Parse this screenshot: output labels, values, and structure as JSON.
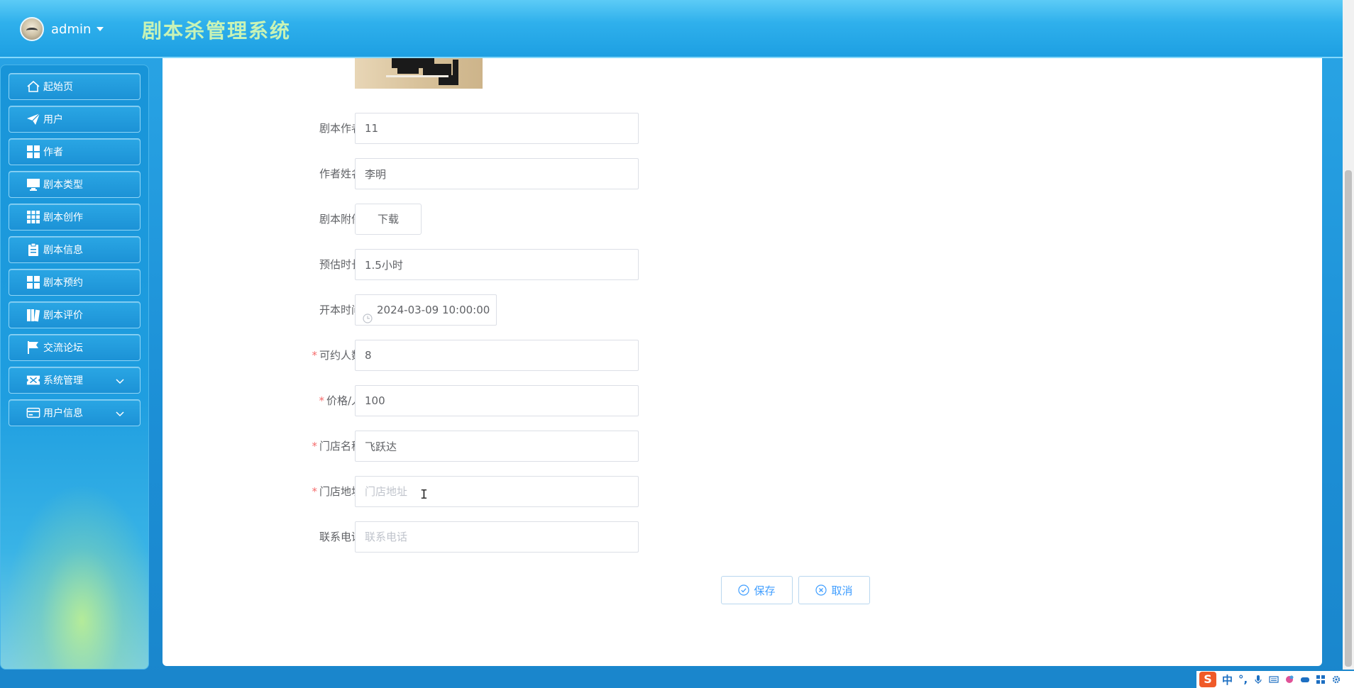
{
  "header": {
    "username": "admin",
    "app_title": "剧本杀管理系统"
  },
  "sidebar": {
    "items": [
      {
        "label": "起始页",
        "icon": "home-icon"
      },
      {
        "label": "用户",
        "icon": "paper-plane-icon"
      },
      {
        "label": "作者",
        "icon": "grid-icon"
      },
      {
        "label": "剧本类型",
        "icon": "monitor-icon"
      },
      {
        "label": "剧本创作",
        "icon": "apps-icon"
      },
      {
        "label": "剧本信息",
        "icon": "clipboard-icon"
      },
      {
        "label": "剧本预约",
        "icon": "grid-icon"
      },
      {
        "label": "剧本评价",
        "icon": "books-icon"
      },
      {
        "label": "交流论坛",
        "icon": "flag-icon"
      },
      {
        "label": "系统管理",
        "icon": "ticket-icon",
        "expandable": true
      },
      {
        "label": "用户信息",
        "icon": "card-icon",
        "expandable": true
      }
    ]
  },
  "form": {
    "author_label": "剧本作者",
    "author_value": "11",
    "author_name_label": "作者姓名",
    "author_name_value": "李明",
    "attachment_label": "剧本附件",
    "download_label": "下载",
    "duration_label": "预估时长",
    "duration_value": "1.5小时",
    "start_time_label": "开本时间",
    "start_time_value": "2024-03-09 10:00:00",
    "capacity_label": "可约人数",
    "capacity_value": "8",
    "price_label": "价格/人",
    "price_value": "100",
    "store_name_label": "门店名称",
    "store_name_value": "飞跃达",
    "store_address_label": "门店地址",
    "store_address_placeholder": "门店地址",
    "phone_label": "联系电话",
    "phone_placeholder": "联系电话",
    "required_mark": "*"
  },
  "actions": {
    "save_label": "保存",
    "cancel_label": "取消"
  },
  "ime": {
    "logo": "S",
    "mode": "中",
    "punct": "°,"
  },
  "colors": {
    "primary": "#409eff",
    "required": "#f56c6c",
    "header_title": "#c8f3b6"
  }
}
